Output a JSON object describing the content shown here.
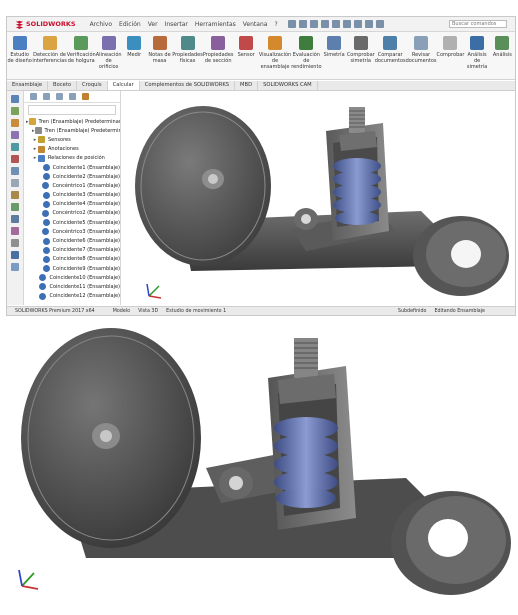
{
  "app": {
    "logo_text": "SOLIDWORKS",
    "brand_color": "#c8102e",
    "menu": [
      "Archivo",
      "Edición",
      "Ver",
      "Insertar",
      "Herramientas",
      "Ventana",
      "?"
    ],
    "search_placeholder": "Buscar comandos"
  },
  "ribbon": {
    "tools": [
      {
        "label": "Estudio de diseño",
        "icon": "design-study-icon",
        "color": "#4a7fc1"
      },
      {
        "label": "Detección de interferencias",
        "icon": "interference-icon",
        "color": "#d9a441"
      },
      {
        "label": "Verificación de holgura",
        "icon": "clearance-icon",
        "color": "#5a9a5a"
      },
      {
        "label": "Alineación de orificios",
        "icon": "hole-align-icon",
        "color": "#7b6fb0"
      },
      {
        "label": "Medir",
        "icon": "measure-icon",
        "color": "#3a8fbf"
      },
      {
        "label": "Notas de masa",
        "icon": "mass-icon",
        "color": "#b86b3a"
      },
      {
        "label": "Propiedades físicas",
        "icon": "properties-icon",
        "color": "#4f8a8b"
      },
      {
        "label": "Propiedades de sección",
        "icon": "section-icon",
        "color": "#8a5f9e"
      },
      {
        "label": "Sensor",
        "icon": "sensor-icon",
        "color": "#c04a4a"
      },
      {
        "label": "Visualización de ensamblaje",
        "icon": "visualization-icon",
        "color": "#d48a2c"
      },
      {
        "label": "Evaluación de rendimiento",
        "icon": "performance-icon",
        "color": "#3e7d3e"
      },
      {
        "label": "Simetría",
        "icon": "symmetry-icon",
        "color": "#5c7fae"
      },
      {
        "label": "Comprobar simetría",
        "icon": "check-icon",
        "color": "#6a6a6a"
      },
      {
        "label": "Comparar documentos",
        "icon": "compare-icon",
        "color": "#4d7fa8"
      },
      {
        "label": "Revisar documentos",
        "icon": "review-icon",
        "color": "#8aa0b8"
      },
      {
        "label": "Comprobar",
        "icon": "verify-icon",
        "color": "#b0b0b0"
      },
      {
        "label": "Análisis de simetría",
        "icon": "analysis-icon",
        "color": "#3b6ea5"
      },
      {
        "label": "Análisis",
        "icon": "analysis2-icon",
        "color": "#5a8f5a"
      }
    ]
  },
  "tabs": [
    {
      "label": "Ensamblaje",
      "active": false
    },
    {
      "label": "Boceto",
      "active": false
    },
    {
      "label": "Croquis",
      "active": false
    },
    {
      "label": "Calcular",
      "active": true
    },
    {
      "label": "Complementos de SOLIDWORKS",
      "active": false
    },
    {
      "label": "MBD",
      "active": false
    },
    {
      "label": "SOLIDWORKS CAM",
      "active": false
    }
  ],
  "tree": {
    "filter_placeholder": "",
    "rows": [
      {
        "label": "Tren (Ensamblaje) Predeterminado",
        "icon": "assembly-icon",
        "color": "#d6a53a",
        "indent": 0
      },
      {
        "label": "Tren (Ensamblaje) Predeterminado",
        "icon": "history-icon",
        "color": "#8a8a8a",
        "indent": 1
      },
      {
        "label": "Sensores",
        "icon": "sensor-icon",
        "color": "#c0a030",
        "indent": 1
      },
      {
        "label": "Anotaciones",
        "icon": "annotation-icon",
        "color": "#c08830",
        "indent": 1
      },
      {
        "label": "Relaciones de posición",
        "icon": "mates-icon",
        "color": "#4a7fc1",
        "indent": 1
      },
      {
        "label": "Coincidente1 (Ensamblaje)",
        "icon": "mate-icon",
        "color": "#3d6fb5",
        "indent": 2
      },
      {
        "label": "Coincidente2 (Ensamblaje)",
        "icon": "mate-icon",
        "color": "#3d6fb5",
        "indent": 2
      },
      {
        "label": "Concéntrico1 (Ensamblaje)",
        "icon": "mate-icon",
        "color": "#3d6fb5",
        "indent": 2
      },
      {
        "label": "Coincidente3 (Ensamblaje)",
        "icon": "mate-icon",
        "color": "#3d6fb5",
        "indent": 2
      },
      {
        "label": "Coincidente4 (Ensamblaje)",
        "icon": "mate-icon",
        "color": "#3d6fb5",
        "indent": 2
      },
      {
        "label": "Concéntrico2 (Ensamblaje)",
        "icon": "mate-icon",
        "color": "#3d6fb5",
        "indent": 2
      },
      {
        "label": "Coincidente5 (Ensamblaje)",
        "icon": "mate-icon",
        "color": "#3d6fb5",
        "indent": 2
      },
      {
        "label": "Concéntrico3 (Ensamblaje)",
        "icon": "mate-icon",
        "color": "#3d6fb5",
        "indent": 2
      },
      {
        "label": "Coincidente6 (Ensamblaje)",
        "icon": "mate-icon",
        "color": "#3d6fb5",
        "indent": 2
      },
      {
        "label": "Coincidente7 (Ensamblaje)",
        "icon": "mate-icon",
        "color": "#3d6fb5",
        "indent": 2
      },
      {
        "label": "Coincidente8 (Ensamblaje)",
        "icon": "mate-icon",
        "color": "#3d6fb5",
        "indent": 2
      },
      {
        "label": "Coincidente9 (Ensamblaje)",
        "icon": "mate-icon",
        "color": "#3d6fb5",
        "indent": 2
      },
      {
        "label": "Coincidente10 (Ensamblaje)",
        "icon": "mate-icon",
        "color": "#3d6fb5",
        "indent": 2
      },
      {
        "label": "Coincidente11 (Ensamblaje)",
        "icon": "mate-icon",
        "color": "#3d6fb5",
        "indent": 2
      },
      {
        "label": "Coincidente12 (Ensamblaje)",
        "icon": "mate-icon",
        "color": "#3d6fb5",
        "indent": 2
      }
    ]
  },
  "statusbar": {
    "left": "SOLIDWORKS Premium 2017 x64",
    "tab1": "Modelo",
    "tab2": "Vista 3D",
    "tab3": "Estudio de movimiento 1",
    "mid": "Subdefinido",
    "right": "Editando Ensamblaje"
  },
  "colors": {
    "metal_dark": "#4a4a4a",
    "metal_mid": "#6b6b6b",
    "spring_blue": "#5a6fa8"
  }
}
